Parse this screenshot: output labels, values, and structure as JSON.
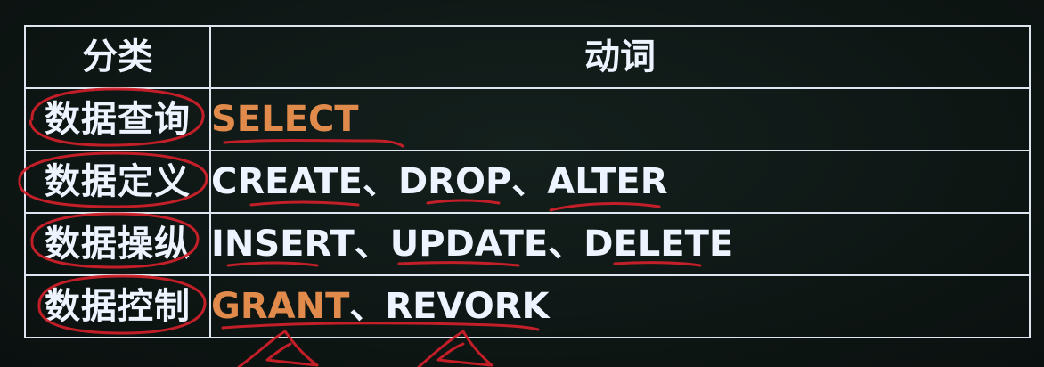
{
  "table": {
    "headers": {
      "category": "分类",
      "verb": "动词"
    },
    "rows": [
      {
        "category": "数据查询",
        "verbs": [
          "SELECT"
        ],
        "highlight": "orange"
      },
      {
        "category": "数据定义",
        "verbs": [
          "CREATE",
          "DROP",
          "ALTER"
        ],
        "highlight": "white"
      },
      {
        "category": "数据操纵",
        "verbs": [
          "INSERT",
          "UPDATE",
          "DELETE"
        ],
        "highlight": "white"
      },
      {
        "category": "数据控制",
        "verbs": [
          "GRANT",
          "REVORK"
        ],
        "highlight": "mixed"
      }
    ],
    "separator": "、"
  },
  "colors": {
    "background": "#0f1816",
    "grid": "#dfe6ef",
    "text": "#eef4ff",
    "accent_orange": "#e08a4c",
    "annotation_red": "#d2202a"
  }
}
